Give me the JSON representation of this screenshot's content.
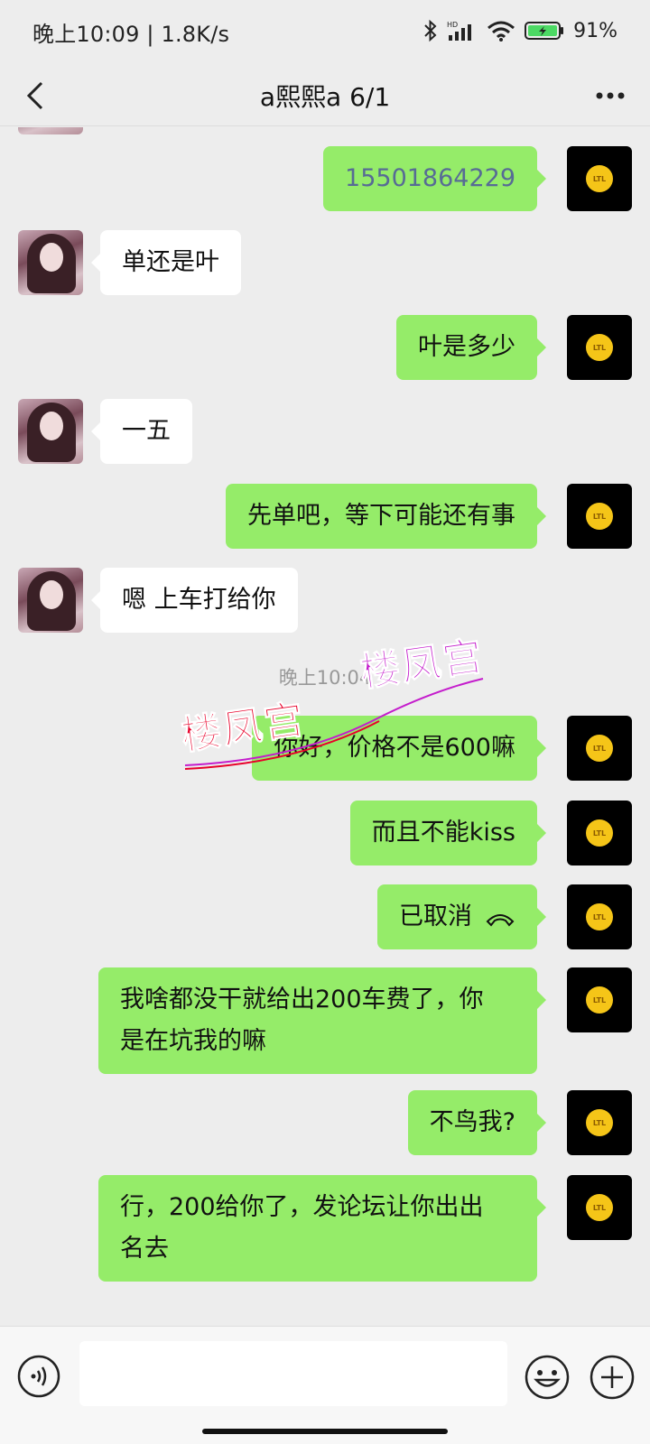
{
  "status_bar": {
    "time_speed": "晚上10:09 | 1.8K/s",
    "battery": "91%"
  },
  "header": {
    "title": "a熙熙a  6/1"
  },
  "messages": [
    {
      "side": "right",
      "text": "15501864229",
      "kind": "phone"
    },
    {
      "side": "left",
      "text": "单还是叶"
    },
    {
      "side": "right",
      "text": "叶是多少"
    },
    {
      "side": "left",
      "text": "一五"
    },
    {
      "side": "right",
      "text": "先单吧，等下可能还有事"
    },
    {
      "side": "left",
      "text": "嗯 上车打给你"
    },
    {
      "side": "right",
      "text": "你好，价格不是600嘛"
    },
    {
      "side": "right",
      "text": "而且不能kiss"
    },
    {
      "side": "right",
      "text": "已取消",
      "kind": "call"
    },
    {
      "side": "right",
      "text_line1": "我啥都没干就给出200车费了，你",
      "text_line2": "是在坑我的嘛"
    },
    {
      "side": "right",
      "text": "不鸟我?"
    },
    {
      "side": "right",
      "text_line1": "行，200给你了，发论坛让你出出",
      "text_line2": "名去"
    }
  ],
  "timestamp": "晚上10:04",
  "watermark": {
    "text1": "楼凤宫",
    "text2": "楼凤宫"
  },
  "avatar_right_label": "LTL",
  "input": {
    "value": "",
    "placeholder": ""
  },
  "colors": {
    "background": "#ededed",
    "bubble_self": "#95ec69",
    "bubble_other": "#ffffff",
    "timestamp": "#999999",
    "phone_link": "#576b95"
  }
}
